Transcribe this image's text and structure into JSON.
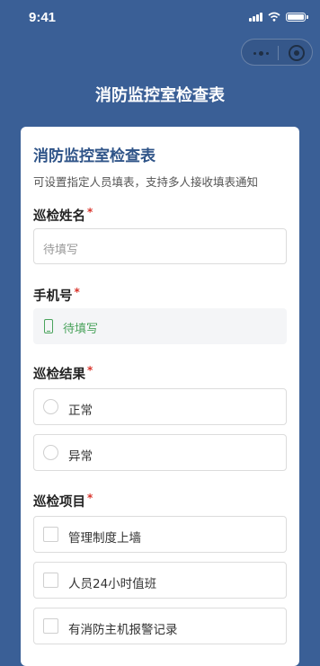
{
  "status_bar": {
    "time": "9:41"
  },
  "nav": {
    "title": "消防监控室检查表"
  },
  "form": {
    "title": "消防监控室检查表",
    "description": "可设置指定人员填表，支持多人接收填表通知"
  },
  "fields": {
    "name": {
      "label": "巡检姓名",
      "required_mark": "*",
      "placeholder": "待填写"
    },
    "phone": {
      "label": "手机号",
      "required_mark": "*",
      "placeholder": "待填写"
    },
    "result": {
      "label": "巡检结果",
      "required_mark": "*",
      "options": [
        "正常",
        "异常"
      ]
    },
    "items": {
      "label": "巡检项目",
      "required_mark": "*",
      "options": [
        "管理制度上墙",
        "人员24小时值班",
        "有消防主机报警记录"
      ]
    }
  },
  "colors": {
    "header_bg": "#3a5f96",
    "title_blue": "#2f5488",
    "required_red": "#d9342b",
    "phone_green": "#4aa35c"
  }
}
